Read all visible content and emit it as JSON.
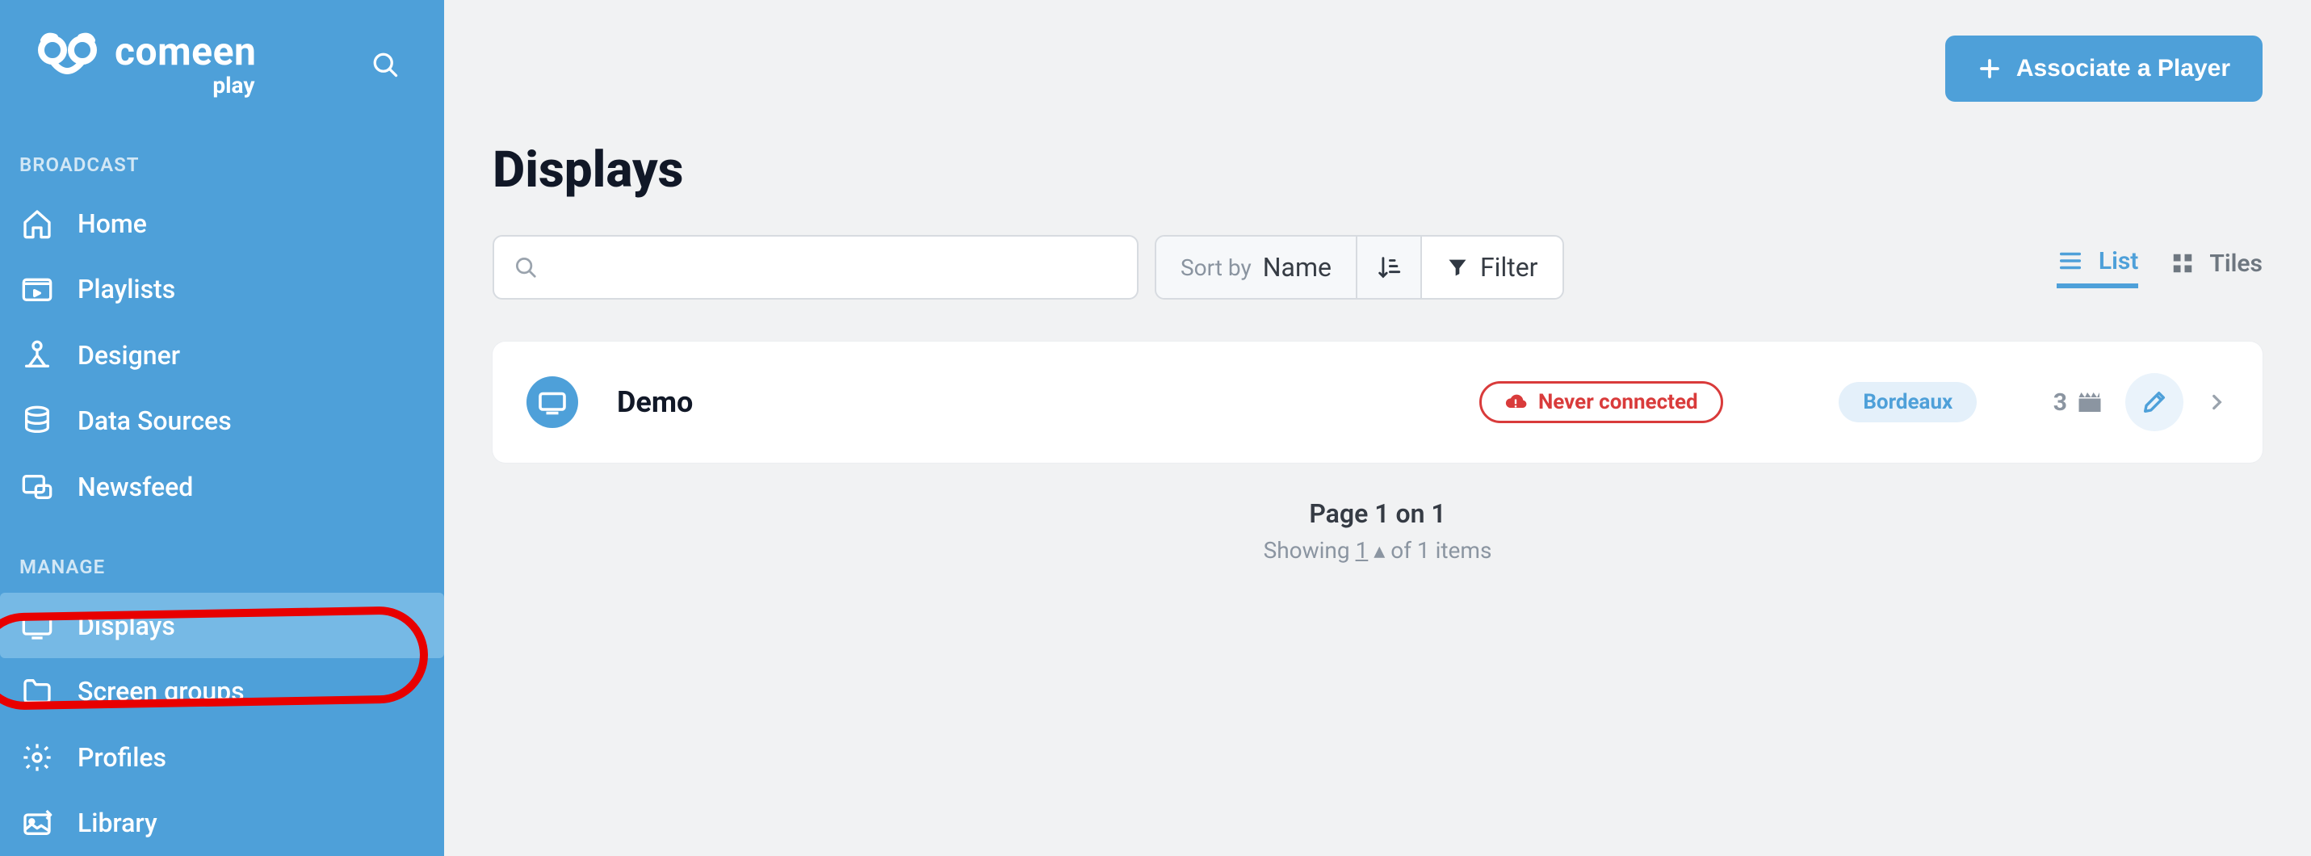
{
  "brand": {
    "name": "comeen",
    "sub": "play"
  },
  "sidebar": {
    "sections": [
      {
        "label": "Broadcast",
        "items": [
          {
            "key": "home",
            "label": "Home"
          },
          {
            "key": "playlists",
            "label": "Playlists"
          },
          {
            "key": "designer",
            "label": "Designer"
          },
          {
            "key": "datasources",
            "label": "Data Sources"
          },
          {
            "key": "newsfeed",
            "label": "Newsfeed"
          }
        ]
      },
      {
        "label": "Manage",
        "items": [
          {
            "key": "displays",
            "label": "Displays",
            "active": true
          },
          {
            "key": "screengroups",
            "label": "Screen groups"
          },
          {
            "key": "profiles",
            "label": "Profiles"
          },
          {
            "key": "library",
            "label": "Library"
          }
        ]
      }
    ]
  },
  "header": {
    "associate_label": "Associate a Player",
    "page_title": "Displays"
  },
  "controls": {
    "search_placeholder": "",
    "sort_prefix": "Sort by",
    "sort_value": "Name",
    "filter_label": "Filter",
    "view_list": "List",
    "view_tiles": "Tiles"
  },
  "rows": [
    {
      "name": "Demo",
      "status": "Never connected",
      "tag": "Bordeaux",
      "count": "3"
    }
  ],
  "pagination": {
    "line1": "Page 1 on 1",
    "line2_pre": "Showing ",
    "line2_num": "1",
    "line2_post": " of 1 items"
  }
}
